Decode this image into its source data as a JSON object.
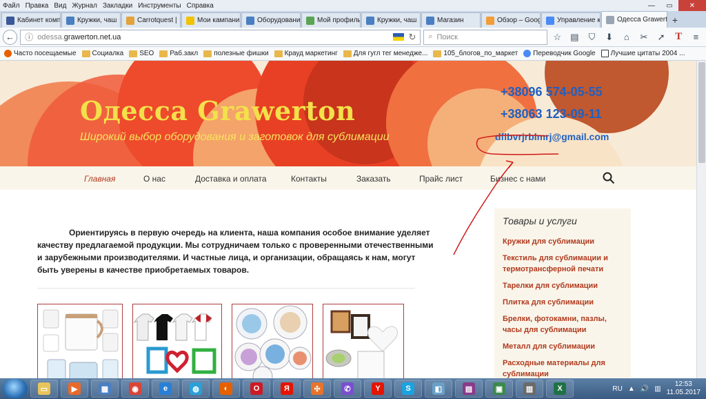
{
  "menu": [
    "Файл",
    "Правка",
    "Вид",
    "Журнал",
    "Закладки",
    "Инструменты",
    "Справка"
  ],
  "tabs": [
    {
      "label": "Кабинет комп",
      "color": "#3b5998"
    },
    {
      "label": "Кружки, чаш",
      "color": "#4a7fc1"
    },
    {
      "label": "Carrotquest |",
      "color": "#e2a33c"
    },
    {
      "label": "Мои кампани",
      "color": "#f2c200"
    },
    {
      "label": "Оборудовани",
      "color": "#4a7fc1"
    },
    {
      "label": "Мой профиль",
      "color": "#5aa454"
    },
    {
      "label": "Кружки, чаш",
      "color": "#4a7fc1"
    },
    {
      "label": "Магазин",
      "color": "#4a7fc1"
    },
    {
      "label": "Обзор – Goog",
      "color": "#f29d38"
    },
    {
      "label": "Управление к",
      "color": "#4a8af4"
    },
    {
      "label": "Одесса Grawert",
      "color": "#9aa5b4",
      "active": true
    }
  ],
  "address": {
    "domain_prefix": "odessa.",
    "domain": "grawerton.net.ua"
  },
  "search": {
    "placeholder": "Поиск"
  },
  "bookmarks": [
    {
      "label": "Часто посещаемые",
      "icon": "firefox-icon"
    },
    {
      "label": "Социалка",
      "icon": "folder-icon"
    },
    {
      "label": "SEO",
      "icon": "folder-icon"
    },
    {
      "label": "Раб.закл",
      "icon": "folder-icon"
    },
    {
      "label": "полезные фишки",
      "icon": "folder-icon"
    },
    {
      "label": "Крауд маркетинг",
      "icon": "folder-icon"
    },
    {
      "label": "Для гугл тег менедже...",
      "icon": "folder-icon"
    },
    {
      "label": "105_блогов_по_маркет",
      "icon": "folder-icon"
    },
    {
      "label": "Переводчик Google",
      "icon": "google-icon"
    },
    {
      "label": "Лучшие цитаты 2004 ...",
      "icon": "b-icon"
    }
  ],
  "site": {
    "title": "Одесса Grawerton",
    "tagline": "Широкий выбор оборудования и заготовок для сублимации",
    "phone1": "+38096 574-05-55",
    "phone2": "+38063 123-09-11",
    "email": "dflbvrjrblmrj@gmail.com"
  },
  "nav": [
    "Главная",
    "О нас",
    "Доставка и оплата",
    "Контакты",
    "Заказать",
    "Прайс лист",
    "Бизнес с нами"
  ],
  "intro": "Ориентируясь в первую очередь на клиента, наша компания особое внимание уделяет качеству предлагаемой продукции. Мы сотрудничаем только с проверенными отечественными и зарубежными производителями. И частные лица, и организации, обращаясь к нам, могут быть уверены в качестве приобретаемых товаров.",
  "sidebar": {
    "title": "Товары и услуги",
    "items": [
      "Кружки для сублимации",
      "Текстиль для сублимации и термотрансферной печати",
      "Тарелки для сублимации",
      "Плитка для сублимации",
      "Брелки, фотокамни, пазлы, часы для сублимации",
      "Металл для сублимации",
      "Расходные материалы для сублимации"
    ]
  },
  "taskbar": {
    "lang": "RU",
    "time": "12:53",
    "date": "11.05.2017",
    "apps": [
      {
        "name": "explorer",
        "glyph": "▭",
        "color": "#e8c45a"
      },
      {
        "name": "media",
        "glyph": "▶",
        "color": "#e86a2a"
      },
      {
        "name": "store",
        "glyph": "▦",
        "color": "#4a7fc1"
      },
      {
        "name": "chrome",
        "glyph": "◉",
        "color": "#db4437"
      },
      {
        "name": "ie-browser",
        "glyph": "e",
        "color": "#2a7fd4"
      },
      {
        "name": "skype-old",
        "glyph": "◍",
        "color": "#2aa0d8"
      },
      {
        "name": "firefox",
        "glyph": "◐",
        "color": "#e66000"
      },
      {
        "name": "opera",
        "glyph": "O",
        "color": "#cc1b24"
      },
      {
        "name": "yandex",
        "glyph": "Я",
        "color": "#e61400"
      },
      {
        "name": "tool",
        "glyph": "✣",
        "color": "#e8742a"
      },
      {
        "name": "viber",
        "glyph": "✆",
        "color": "#7a4fcf"
      },
      {
        "name": "yandex-browser",
        "glyph": "Y",
        "color": "#e61400"
      },
      {
        "name": "skype",
        "glyph": "S",
        "color": "#1aa3e0"
      },
      {
        "name": "notes",
        "glyph": "◧",
        "color": "#6aa0c8"
      },
      {
        "name": "winrar",
        "glyph": "▤",
        "color": "#8a3a8a"
      },
      {
        "name": "monitor",
        "glyph": "▣",
        "color": "#3a8a4a"
      },
      {
        "name": "archive",
        "glyph": "▥",
        "color": "#6a6a6a"
      },
      {
        "name": "excel",
        "glyph": "X",
        "color": "#1f7244"
      }
    ]
  }
}
